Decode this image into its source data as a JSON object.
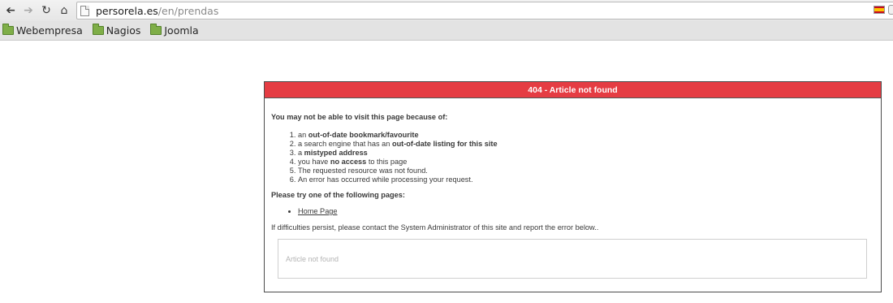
{
  "browser": {
    "url_host": "persorela.es",
    "url_path": "/en/prendas",
    "nav": {
      "back_icon": "arrow-left-icon",
      "forward_icon": "arrow-right-icon",
      "reload_icon": "reload-icon",
      "home_icon": "home-icon"
    },
    "flag_colors": {
      "red": "#c60b1e",
      "yellow": "#ffc400"
    }
  },
  "bookmarks": [
    {
      "label": "Webempresa",
      "icon": "folder-icon"
    },
    {
      "label": "Nagios",
      "icon": "folder-icon"
    },
    {
      "label": "Joomla",
      "icon": "folder-icon"
    }
  ],
  "error": {
    "title": "404 - Article not found",
    "header_color": "#e53c43",
    "intro": "You may not be able to visit this page because of:",
    "reasons": [
      {
        "pre": "an ",
        "bold": "out-of-date bookmark/favourite",
        "post": ""
      },
      {
        "pre": "a search engine that has an ",
        "bold": "out-of-date listing for this site",
        "post": ""
      },
      {
        "pre": "a ",
        "bold": "mistyped address",
        "post": ""
      },
      {
        "pre": "you have ",
        "bold": "no access",
        "post": " to this page"
      },
      {
        "pre": "The requested resource was not found.",
        "bold": "",
        "post": ""
      },
      {
        "pre": "An error has occurred while processing your request.",
        "bold": "",
        "post": ""
      }
    ],
    "try_heading": "Please try one of the following pages:",
    "pages": [
      "Home Page"
    ],
    "contact": "If difficulties persist, please contact the System Administrator of this site and report the error below..",
    "detail": "Article not found"
  }
}
